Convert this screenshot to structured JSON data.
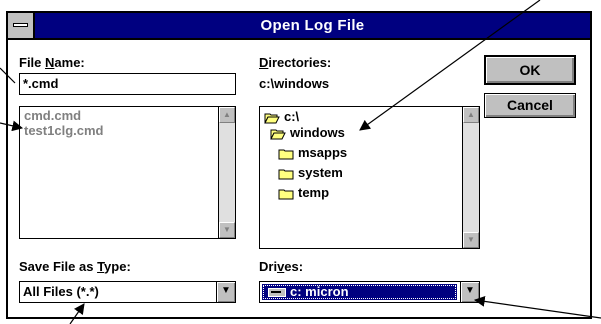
{
  "dialog": {
    "title": "Open Log File"
  },
  "file_name": {
    "label_pre": "File ",
    "label_u": "N",
    "label_post": "ame:",
    "value": "*.cmd",
    "files": [
      "cmd.cmd",
      "test1clg.cmd"
    ]
  },
  "directories": {
    "label_u": "D",
    "label_post": "irectories:",
    "current_path": "c:\\windows",
    "tree": [
      "c:\\",
      "windows",
      "msapps",
      "system",
      "temp"
    ]
  },
  "save_type": {
    "label_pre": "Save File as ",
    "label_u": "T",
    "label_post": "ype:",
    "value": "All Files (*.*)"
  },
  "drives": {
    "label_pre": "Dri",
    "label_u": "v",
    "label_post": "es:",
    "value": "c: micron"
  },
  "buttons": {
    "ok": "OK",
    "cancel": "Cancel"
  },
  "icons": {
    "scroll_up": "up-arrow-icon",
    "scroll_down": "down-arrow-icon",
    "dropdown": "down-arrow-icon",
    "open_folder": "open-folder-icon",
    "closed_folder": "folder-icon",
    "drive": "hard-drive-icon"
  },
  "colors": {
    "titlebar": "#000080",
    "selection": "#000080",
    "face": "#c0c0c0",
    "disabled_text": "#808080"
  }
}
